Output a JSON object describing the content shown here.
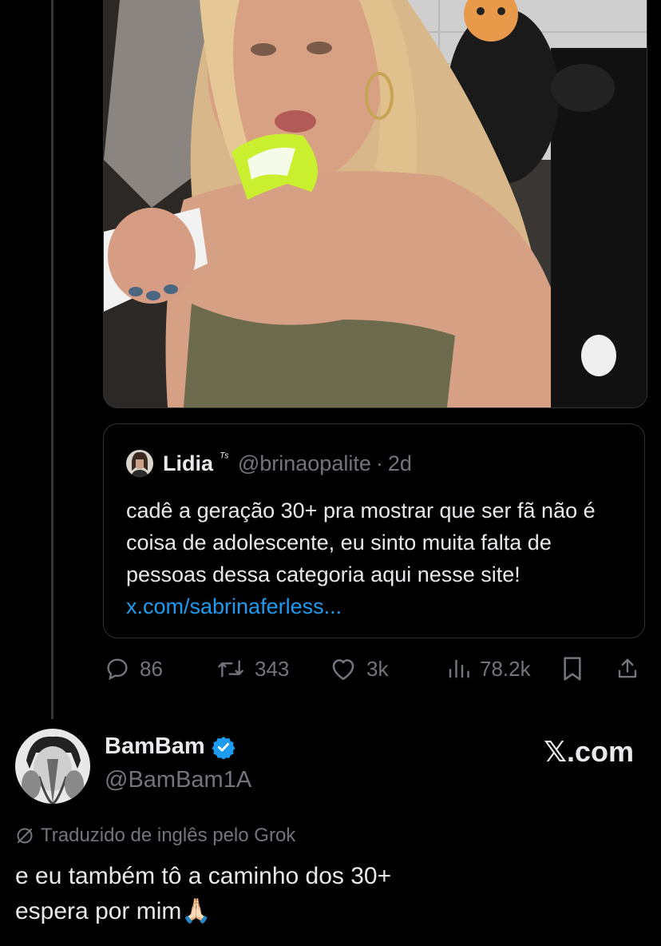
{
  "quoted": {
    "name": "Lidia",
    "name_suffix": "ᵀˢ",
    "handle": "@brinaopalite",
    "separator": "·",
    "age": "2d",
    "text": "cadê a geração 30+ pra mostrar que ser fã não é coisa de adolescente, eu sinto muita falta de pessoas dessa categoria aqui nesse site!",
    "link": "x.com/sabrinaferless..."
  },
  "actions": {
    "replies": "86",
    "reposts": "343",
    "likes": "3k",
    "views": "78.2k"
  },
  "reply": {
    "name": "BamBam",
    "handle": "@BamBam1A",
    "translation_note": "Traduzido de inglês pelo Grok",
    "line1": "e eu também tô a caminho dos 30+",
    "line2": "espera por mim",
    "emoji": "🙏🏻"
  },
  "brand": {
    "logo_text": "𝕏.com"
  },
  "colors": {
    "background": "#000000",
    "text": "#e7e9ea",
    "muted": "#71767b",
    "link": "#1d9bf0",
    "border": "#2f3336",
    "verified": "#1d9bf0"
  }
}
